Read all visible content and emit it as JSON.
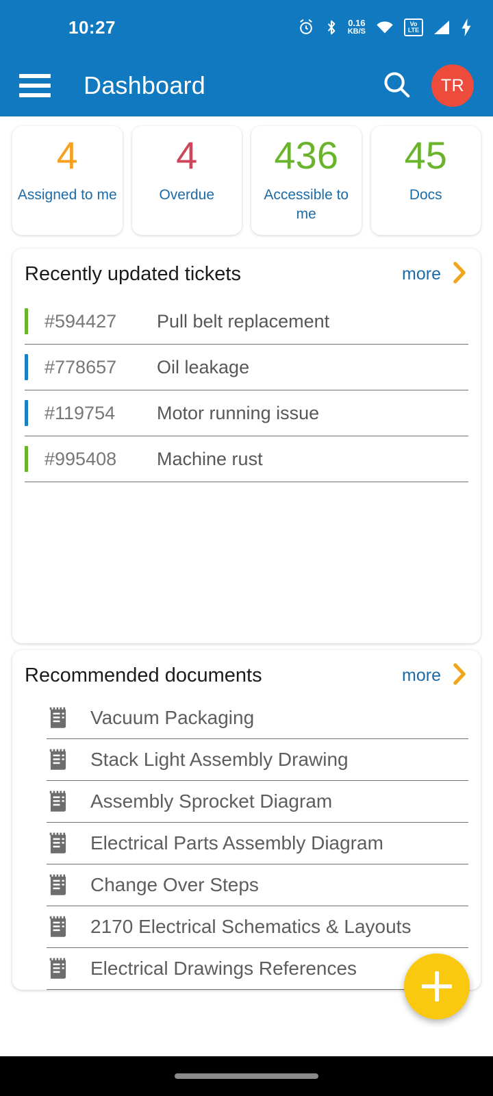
{
  "status_bar": {
    "time": "10:27",
    "data_rate_value": "0.16",
    "data_rate_unit": "KB/S",
    "volte_top": "Vo",
    "volte_bottom": "LTE",
    "icons": [
      "alarm-icon",
      "bluetooth-icon",
      "data-rate-indicator",
      "wifi-icon",
      "volte-icon",
      "signal-icon",
      "charging-bolt-icon"
    ]
  },
  "appbar": {
    "menu_icon": "hamburger-menu-icon",
    "title": "Dashboard",
    "search_icon": "search-icon",
    "avatar_initials": "TR",
    "avatar_color": "#ed4b3c",
    "background": "#1079bf"
  },
  "stats": [
    {
      "value": "4",
      "label": "Assigned to me",
      "color": "#f5a01e"
    },
    {
      "value": "4",
      "label": "Overdue",
      "color": "#cd4659"
    },
    {
      "value": "436",
      "label": "Accessible to me",
      "color": "#6ab42d"
    },
    {
      "value": "45",
      "label": "Docs",
      "color": "#6ab42d"
    }
  ],
  "tickets_card": {
    "title": "Recently updated tickets",
    "more_label": "more",
    "more_icon": "chevron-right-icon",
    "items": [
      {
        "id": "#594427",
        "title": "Pull belt replacement",
        "status_color": "#6ab42d"
      },
      {
        "id": "#778657",
        "title": "Oil leakage",
        "status_color": "#1b7fc4"
      },
      {
        "id": "#119754",
        "title": "Motor running issue",
        "status_color": "#1b7fc4"
      },
      {
        "id": "#995408",
        "title": "Machine rust",
        "status_color": "#6ab42d"
      }
    ]
  },
  "documents_card": {
    "title": "Recommended documents",
    "more_label": "more",
    "more_icon": "chevron-right-icon",
    "items": [
      {
        "title": "Vacuum Packaging",
        "icon": "document-icon"
      },
      {
        "title": "Stack Light Assembly Drawing",
        "icon": "document-icon"
      },
      {
        "title": "Assembly Sprocket Diagram",
        "icon": "document-icon"
      },
      {
        "title": "Electrical Parts Assembly Diagram",
        "icon": "document-icon"
      },
      {
        "title": "Change Over Steps",
        "icon": "document-icon"
      },
      {
        "title": "2170 Electrical Schematics & Layouts",
        "icon": "document-icon"
      },
      {
        "title": "Electrical Drawings References",
        "icon": "document-icon"
      }
    ]
  },
  "fab": {
    "icon": "plus-icon",
    "color": "#fac90f"
  },
  "nav_bar": {
    "home_indicator": "home-indicator-pill"
  }
}
